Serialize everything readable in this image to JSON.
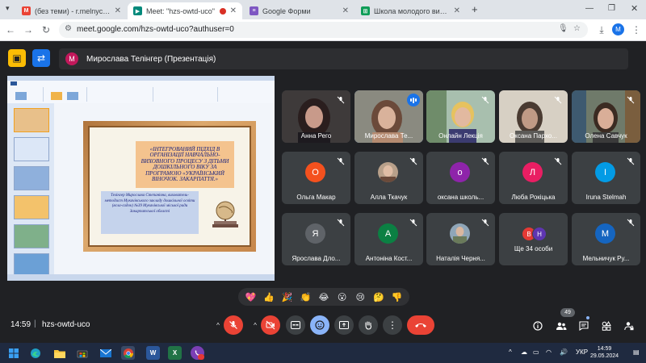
{
  "browser": {
    "tabs": [
      {
        "title": "(без теми) - r.melnychuk@ipp",
        "fav_color": "#ea4335",
        "fav_glyph": "M",
        "active": false
      },
      {
        "title": "Meet: \"hzs-owtd-uco\"",
        "fav_color": "#00897b",
        "fav_glyph": "▶",
        "active": true
      },
      {
        "title": "Google Форми",
        "fav_color": "#7e57c2",
        "fav_glyph": "≡",
        "active": false
      },
      {
        "title": "Школа молодого вихователя",
        "fav_color": "#0f9d58",
        "fav_glyph": "⊞",
        "active": false
      }
    ],
    "new_tab": "+",
    "url": "meet.google.com/hzs-owtd-uco?authuser=0",
    "profile_initial": "M"
  },
  "meet": {
    "presenter": {
      "initial": "M",
      "label": "Мирослава Телінгер (Презентація)"
    },
    "slide": {
      "title": "«ІНТЕГРОВАНИЙ ПІДХІД В ОРГАНІЗАЦІЇ НАВЧАЛЬНО-ВИХОВНОГО ПРОЦЕСУ З ДІТЬМИ ДОШКІЛЬНОГО ВІКУ ЗА ПРОГРАМОЮ «УКРАЇНСЬКИЙ ВІНОЧОК. ЗАКАРПАТТЯ.»",
      "author": "Телінгер Мирослава Степанівна, вихователь-методист Мукачівського закладу дошкільної освіти (ясла-садок) №39 Мукачівської міської ради Закарпатської області"
    },
    "participants": [
      {
        "name": "Анна Рего",
        "type": "video",
        "muted": true
      },
      {
        "name": "Мирослава Те...",
        "type": "video",
        "speaking": true
      },
      {
        "name": "Онлайн Лекція",
        "type": "video",
        "muted": true
      },
      {
        "name": "Оксана Пархо...",
        "type": "video",
        "muted": true
      },
      {
        "name": "Олена Савчук",
        "type": "video",
        "muted": true
      },
      {
        "name": "Ольга Макар",
        "type": "avatar",
        "initial": "О",
        "color": "#f4511e",
        "muted": true
      },
      {
        "name": "Алла Ткачук",
        "type": "photo",
        "muted": true
      },
      {
        "name": "оксана школь...",
        "type": "avatar",
        "initial": "о",
        "color": "#8e24aa",
        "muted": true
      },
      {
        "name": "Люба Рокіцька",
        "type": "avatar",
        "initial": "Л",
        "color": "#e91e63",
        "muted": true
      },
      {
        "name": "Iruna Stelmah",
        "type": "avatar",
        "initial": "I",
        "color": "#039be5",
        "muted": true
      },
      {
        "name": "Ярослава Дло...",
        "type": "avatar",
        "initial": "Я",
        "color": "#5f6368",
        "muted": true
      },
      {
        "name": "Антоніна Кост...",
        "type": "avatar",
        "initial": "А",
        "color": "#0b8043",
        "muted": true
      },
      {
        "name": "Наталія Черня...",
        "type": "photo",
        "muted": true
      },
      {
        "name": "Ще 34 особи",
        "type": "group",
        "initials": [
          "В",
          "Н"
        ],
        "colors": [
          "#e53935",
          "#5e35b1"
        ]
      },
      {
        "name": "Мельничук Ру...",
        "type": "avatar",
        "initial": "М",
        "color": "#1565c0",
        "muted": true
      }
    ],
    "reactions": [
      "💖",
      "👍",
      "🎉",
      "👏",
      "😂",
      "😮",
      "😢",
      "🤔",
      "👎"
    ],
    "time": "14:59",
    "separator": "|",
    "meeting_code": "hzs-owtd-uco",
    "participant_count": "49"
  },
  "taskbar": {
    "lang": "УКР",
    "clock_time": "14:59",
    "clock_date": "29.05.2024",
    "tray_caret": "^"
  }
}
